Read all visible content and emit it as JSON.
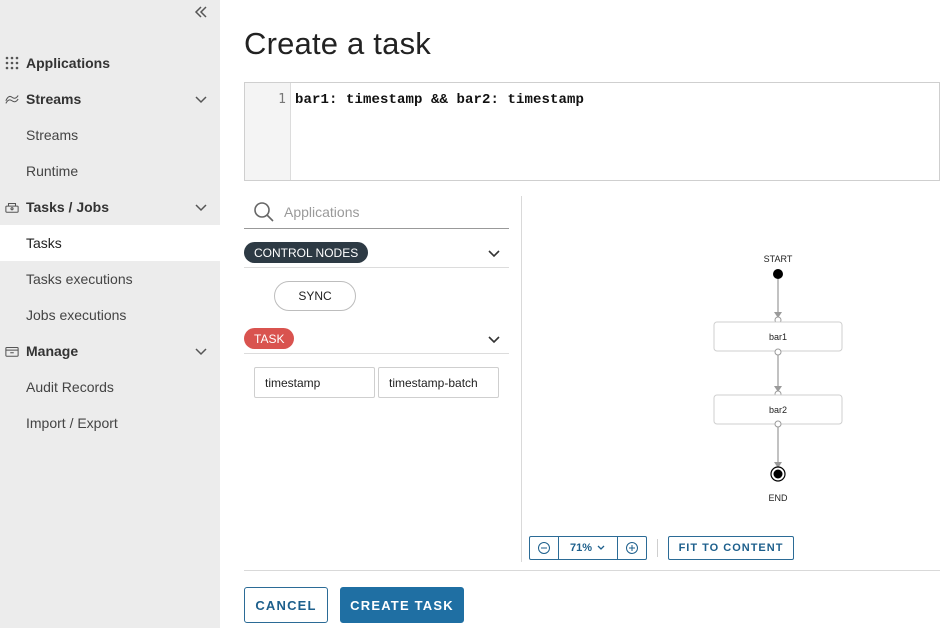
{
  "sidebar": {
    "items": [
      {
        "label": "Applications",
        "type": "section"
      },
      {
        "label": "Streams",
        "type": "section"
      },
      {
        "label": "Streams",
        "type": "sub"
      },
      {
        "label": "Runtime",
        "type": "sub"
      },
      {
        "label": "Tasks / Jobs",
        "type": "section"
      },
      {
        "label": "Tasks",
        "type": "sub",
        "active": true
      },
      {
        "label": "Tasks executions",
        "type": "sub"
      },
      {
        "label": "Jobs executions",
        "type": "sub"
      },
      {
        "label": "Manage",
        "type": "section"
      },
      {
        "label": "Audit Records",
        "type": "sub"
      },
      {
        "label": "Import / Export",
        "type": "sub"
      }
    ]
  },
  "page": {
    "title": "Create a task"
  },
  "editor": {
    "line_number": "1",
    "code": "bar1: timestamp && bar2: timestamp"
  },
  "palette": {
    "search_placeholder": "Applications",
    "control_nodes_label": "CONTROL NODES",
    "sync_label": "SYNC",
    "task_label": "TASK",
    "tasks": [
      "timestamp",
      "timestamp-batch"
    ]
  },
  "flow": {
    "start_label": "START",
    "end_label": "END",
    "nodes": [
      "bar1",
      "bar2"
    ]
  },
  "toolbar": {
    "zoom": "71%",
    "fit_label": "FIT TO CONTENT"
  },
  "actions": {
    "cancel_label": "CANCEL",
    "create_label": "CREATE TASK"
  },
  "colors": {
    "accent": "#1f6fa3",
    "task_badge": "#d9534f",
    "control_badge": "#2d3a44",
    "sidebar_bg": "#ececec"
  }
}
